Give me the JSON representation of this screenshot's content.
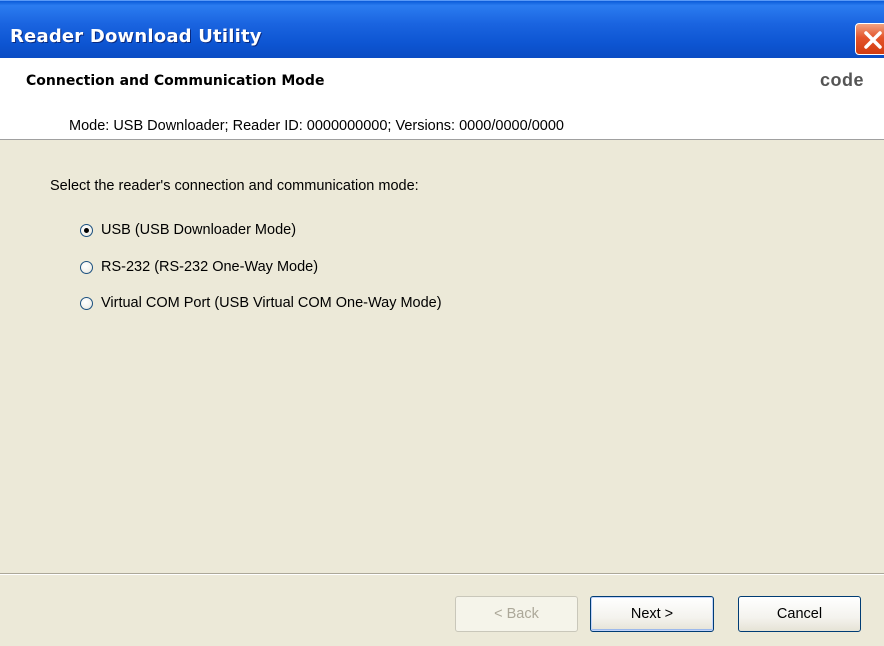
{
  "window": {
    "title": "Reader Download Utility"
  },
  "header": {
    "title": "Connection and Communication Mode",
    "logo_text": "code",
    "info": "Mode: USB Downloader; Reader ID: 0000000000; Versions: 0000/0000/0000"
  },
  "body": {
    "prompt": "Select the reader's connection and communication mode:",
    "options": [
      {
        "label": "USB (USB Downloader Mode)",
        "selected": true
      },
      {
        "label": "RS-232 (RS-232 One-Way Mode)",
        "selected": false
      },
      {
        "label": "Virtual COM Port (USB Virtual COM One-Way Mode)",
        "selected": false
      }
    ]
  },
  "buttons": {
    "back": "< Back",
    "next": "Next >",
    "cancel": "Cancel",
    "back_enabled": false
  },
  "colors": {
    "titlebar": "#0a5bd8",
    "close": "#e4542b",
    "dialog_bg": "#ece9d8",
    "header_bg": "#ffffff"
  },
  "icons": {
    "close": "close-x-icon"
  }
}
